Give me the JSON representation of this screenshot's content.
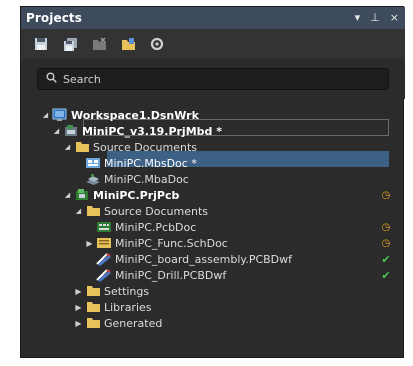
{
  "panel": {
    "title": "Projects",
    "controls": {
      "menu": "▾",
      "pin": "⊥",
      "close": "×"
    }
  },
  "toolbar": {
    "buttons": [
      {
        "name": "save-icon"
      },
      {
        "name": "save-all-icon"
      },
      {
        "name": "close-project-icon"
      },
      {
        "name": "open-folder-icon"
      },
      {
        "name": "settings-icon"
      }
    ]
  },
  "search": {
    "placeholder": "Search",
    "value": ""
  },
  "tree": {
    "workspace": "Workspace1.DsnWrk",
    "project1": "MiniPC_v3.19.PrjMbd *",
    "source1": "Source Documents",
    "mbsdoc": "MiniPC.MbsDoc *",
    "mbadoc": "MiniPC.MbaDoc",
    "project2": "MiniPC.PrjPcb",
    "source2": "Source Documents",
    "pcbdoc": "MiniPC.PcbDoc",
    "schdoc": "MiniPC_Func.SchDoc",
    "assembly": "MiniPC_board_assembly.PCBDwf",
    "drill": "MiniPC_Drill.PCBDwf",
    "settings": "Settings",
    "libraries": "Libraries",
    "generated": "Generated"
  },
  "colors": {
    "accent": "#3d6185",
    "modified": "#e6a51e",
    "ok": "#4cc54c",
    "folder": "#e8c15a"
  }
}
